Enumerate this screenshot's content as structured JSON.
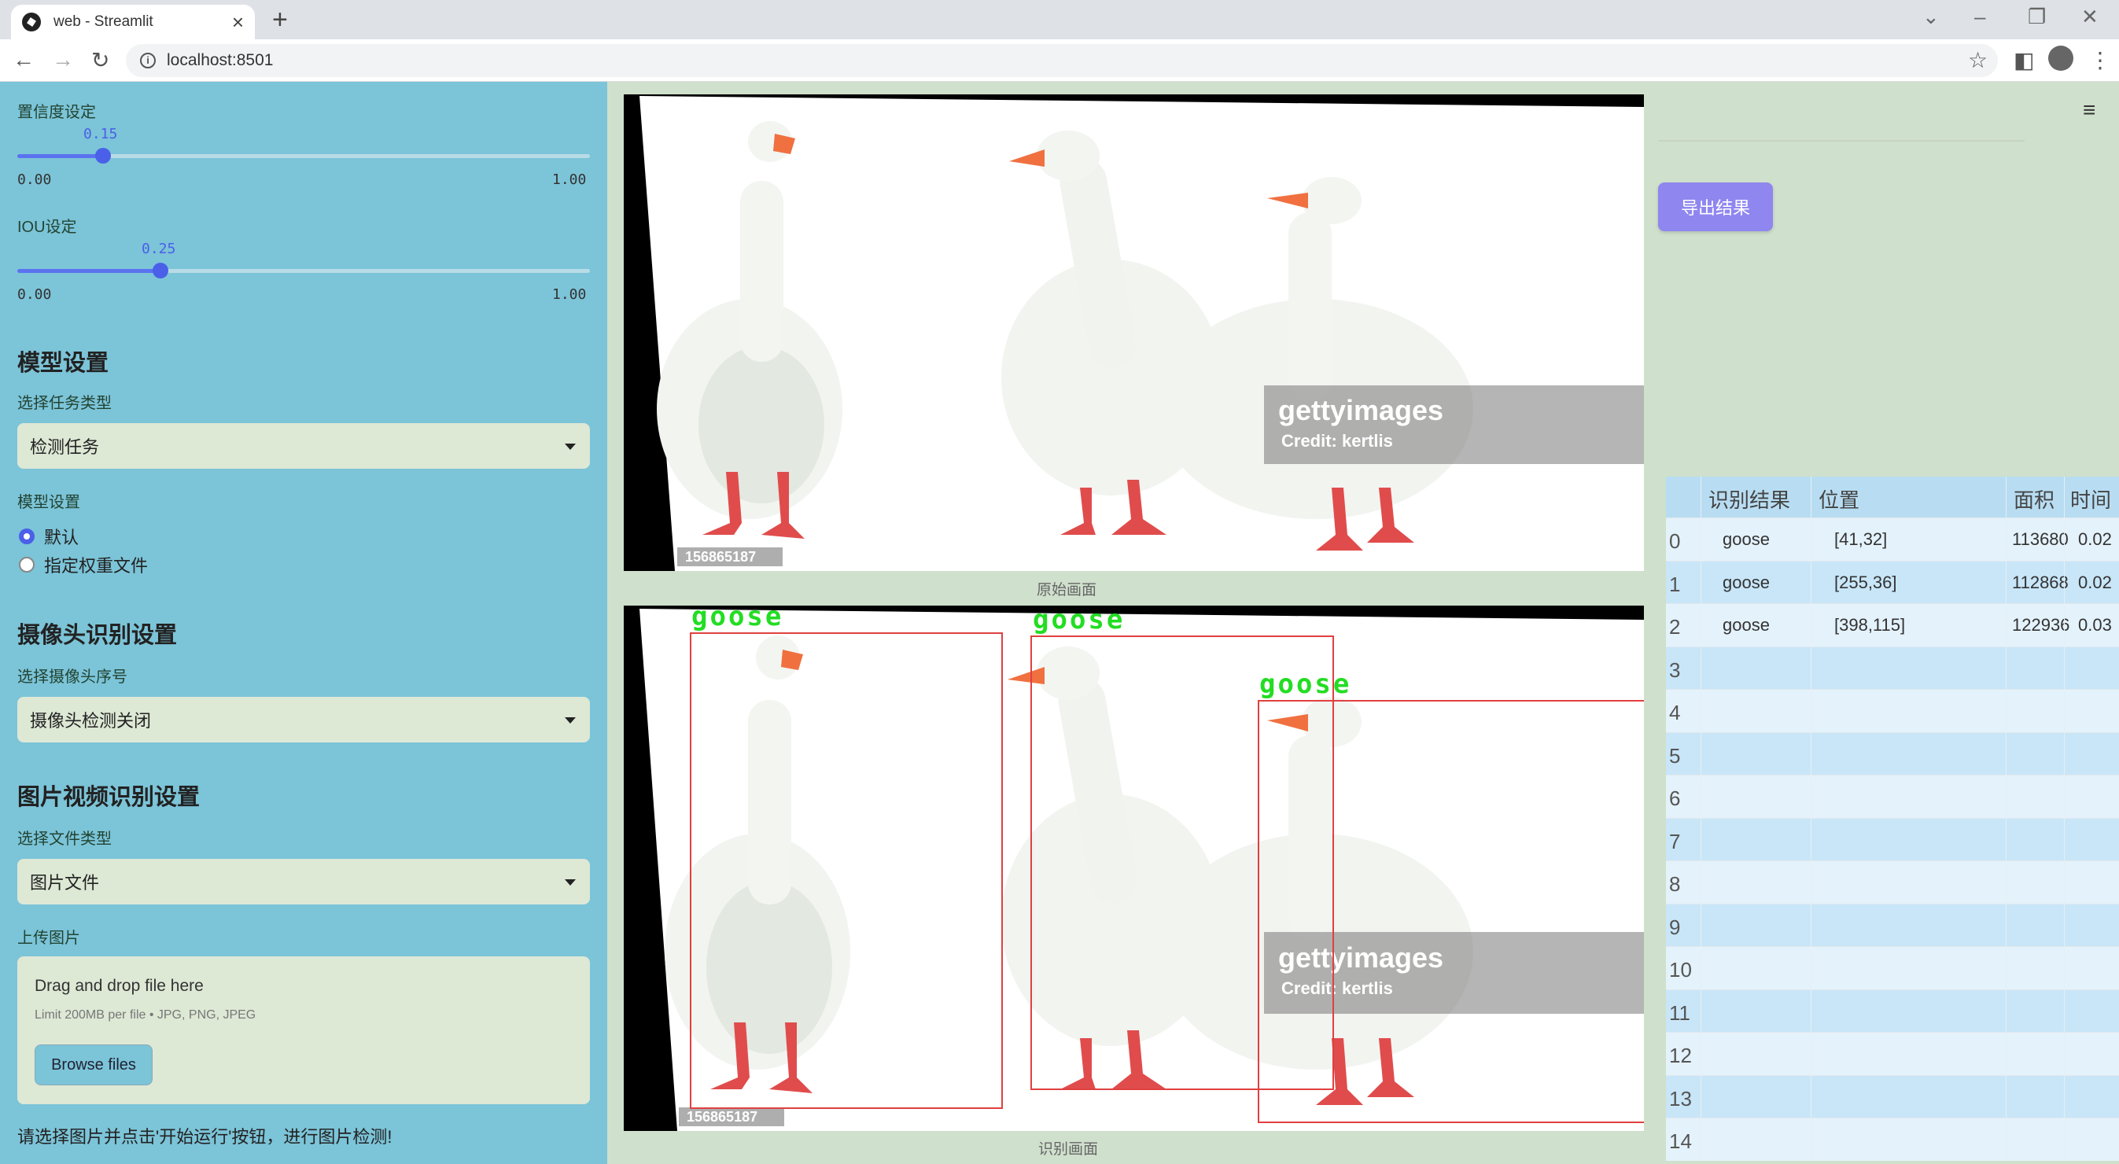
{
  "browser": {
    "tab_title": "web - Streamlit",
    "url": "localhost:8501"
  },
  "sidebar": {
    "confidence": {
      "label": "置信度设定",
      "value": "0.15",
      "min": "0.00",
      "max": "1.00",
      "fraction": 0.15
    },
    "iou": {
      "label": "IOU设定",
      "value": "0.25",
      "min": "0.00",
      "max": "1.00",
      "fraction": 0.25
    },
    "model_section": {
      "heading": "模型设置",
      "task_label": "选择任务类型",
      "task_value": "检测任务",
      "model_label": "模型设置",
      "options": [
        "默认",
        "指定权重文件"
      ],
      "selected": 0
    },
    "camera_section": {
      "heading": "摄像头识别设置",
      "camera_label": "选择摄像头序号",
      "camera_value": "摄像头检测关闭"
    },
    "media_section": {
      "heading": "图片视频识别设置",
      "file_type_label": "选择文件类型",
      "file_type_value": "图片文件",
      "upload_label": "上传图片",
      "drop_title": "Drag and drop file here",
      "drop_sub": "Limit 200MB per file • JPG, PNG, JPEG",
      "browse": "Browse files"
    },
    "note": "请选择图片并点击'开始运行'按钮，进行图片检测!"
  },
  "main": {
    "original_caption": "原始画面",
    "detected_caption": "识别画面",
    "watermark_brand": "gettyimages",
    "watermark_credit": "Credit: kertlis",
    "image_id": "156865187",
    "detections": [
      "goose",
      "goose",
      "goose"
    ]
  },
  "right": {
    "export_button": "导出结果",
    "table": {
      "headers": [
        "识别结果",
        "位置",
        "面积",
        "时间"
      ],
      "rows": [
        {
          "index": "0",
          "result": "goose",
          "position": "[41,32]",
          "area": "113680",
          "time": "0.02"
        },
        {
          "index": "1",
          "result": "goose",
          "position": "[255,36]",
          "area": "112868",
          "time": "0.02"
        },
        {
          "index": "2",
          "result": "goose",
          "position": "[398,115]",
          "area": "122936",
          "time": "0.03"
        },
        {
          "index": "3"
        },
        {
          "index": "4"
        },
        {
          "index": "5"
        },
        {
          "index": "6"
        },
        {
          "index": "7"
        },
        {
          "index": "8"
        },
        {
          "index": "9"
        },
        {
          "index": "10"
        },
        {
          "index": "11"
        },
        {
          "index": "12"
        },
        {
          "index": "13"
        },
        {
          "index": "14"
        }
      ]
    }
  }
}
